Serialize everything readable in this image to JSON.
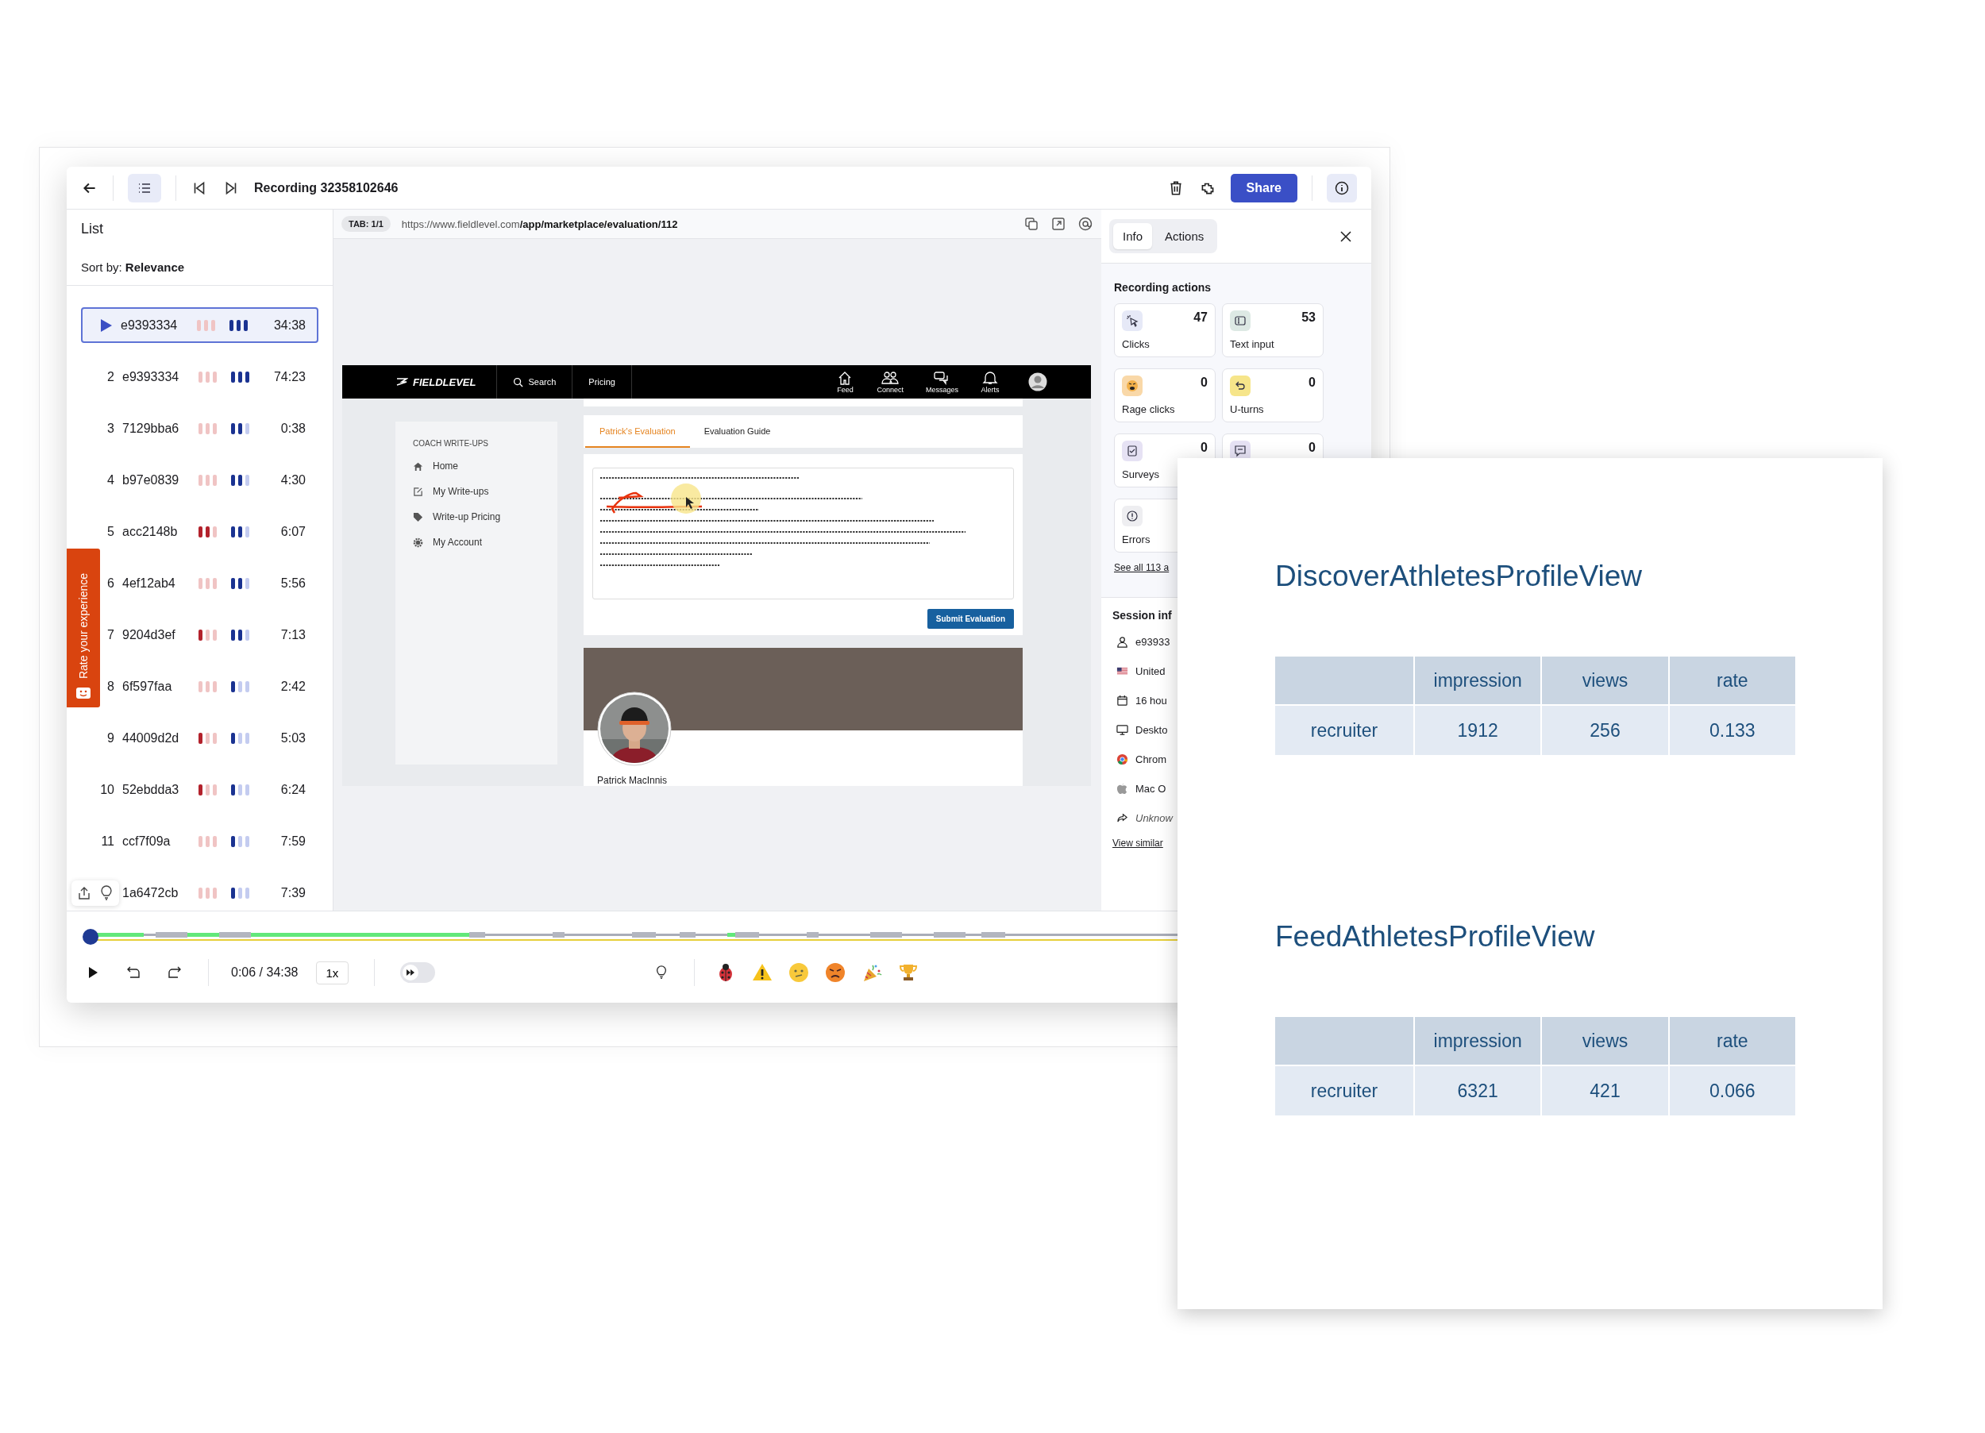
{
  "toolbar": {
    "title": "Recording 32358102646",
    "share_button": "Share"
  },
  "list": {
    "title": "List",
    "sort_label": "Sort by: **Relevance**",
    "items": [
      {
        "id": "e9393334",
        "duration": "34:38",
        "selected": true,
        "frustration": [
          {
            "filled": false
          },
          {
            "filled": false
          },
          {
            "filled": false
          }
        ],
        "engagement": [
          {
            "filled": true
          },
          {
            "filled": true
          },
          {
            "filled": true
          }
        ]
      },
      {
        "index": "2",
        "id": "e9393334",
        "duration": "74:23",
        "selected": false,
        "frustration": [
          {
            "filled": false
          },
          {
            "filled": false
          },
          {
            "filled": false
          }
        ],
        "engagement": [
          {
            "filled": true
          },
          {
            "filled": true
          },
          {
            "filled": true
          }
        ]
      },
      {
        "index": "3",
        "id": "7129bba6",
        "duration": "0:38",
        "selected": false,
        "frustration": [
          {
            "filled": false
          },
          {
            "filled": false
          },
          {
            "filled": false
          }
        ],
        "engagement": [
          {
            "filled": true
          },
          {
            "filled": true
          },
          {
            "filled": false
          }
        ]
      },
      {
        "index": "4",
        "id": "b97e0839",
        "duration": "4:30",
        "selected": false,
        "frustration": [
          {
            "filled": false
          },
          {
            "filled": false
          },
          {
            "filled": false
          }
        ],
        "engagement": [
          {
            "filled": true
          },
          {
            "filled": true
          },
          {
            "filled": false
          }
        ]
      },
      {
        "index": "5",
        "id": "acc2148b",
        "duration": "6:07",
        "selected": false,
        "frustration": [
          {
            "filled": true
          },
          {
            "filled": true
          },
          {
            "filled": false
          }
        ],
        "engagement": [
          {
            "filled": true
          },
          {
            "filled": true
          },
          {
            "filled": false
          }
        ]
      },
      {
        "index": "6",
        "id": "4ef12ab4",
        "duration": "5:56",
        "selected": false,
        "frustration": [
          {
            "filled": false
          },
          {
            "filled": false
          },
          {
            "filled": false
          }
        ],
        "engagement": [
          {
            "filled": true
          },
          {
            "filled": true
          },
          {
            "filled": false
          }
        ]
      },
      {
        "index": "7",
        "id": "9204d3ef",
        "duration": "7:13",
        "selected": false,
        "frustration": [
          {
            "filled": true
          },
          {
            "filled": false
          },
          {
            "filled": false
          }
        ],
        "engagement": [
          {
            "filled": true
          },
          {
            "filled": true
          },
          {
            "filled": false
          }
        ]
      },
      {
        "index": "8",
        "id": "6f597faa",
        "duration": "2:42",
        "selected": false,
        "frustration": [
          {
            "filled": false
          },
          {
            "filled": false
          },
          {
            "filled": false
          }
        ],
        "engagement": [
          {
            "filled": true
          },
          {
            "filled": false
          },
          {
            "filled": false
          }
        ]
      },
      {
        "index": "9",
        "id": "44009d2d",
        "duration": "5:03",
        "selected": false,
        "frustration": [
          {
            "filled": true
          },
          {
            "filled": false
          },
          {
            "filled": false
          }
        ],
        "engagement": [
          {
            "filled": true
          },
          {
            "filled": false
          },
          {
            "filled": false
          }
        ]
      },
      {
        "index": "10",
        "id": "52ebdda3",
        "duration": "6:24",
        "selected": false,
        "frustration": [
          {
            "filled": true
          },
          {
            "filled": false
          },
          {
            "filled": false
          }
        ],
        "engagement": [
          {
            "filled": true
          },
          {
            "filled": false
          },
          {
            "filled": false
          }
        ]
      },
      {
        "index": "11",
        "id": "ccf7f09a",
        "duration": "7:59",
        "selected": false,
        "frustration": [
          {
            "filled": false
          },
          {
            "filled": false
          },
          {
            "filled": false
          }
        ],
        "engagement": [
          {
            "filled": true
          },
          {
            "filled": false
          },
          {
            "filled": false
          }
        ]
      },
      {
        "id": "1a6472cb",
        "duration": "7:39",
        "selected": false,
        "frustration": [
          {
            "filled": false
          },
          {
            "filled": false
          },
          {
            "filled": false
          }
        ],
        "engagement": [
          {
            "filled": true
          },
          {
            "filled": false
          },
          {
            "filled": false
          }
        ]
      }
    ]
  },
  "feedback_tab": {
    "label": "Rate your experience"
  },
  "viewer": {
    "tab_badge": "TAB: 1/1",
    "url": "https://www.fieldlevel.com**/app/marketplace/evaluation/112**"
  },
  "embedded_page": {
    "brand": "FIELDLEVEL",
    "nav_links": [
      "Search",
      "Pricing"
    ],
    "nav_icons": [
      {
        "kind": "home",
        "label": "Feed"
      },
      {
        "kind": "people",
        "label": "Connect"
      },
      {
        "kind": "chat",
        "label": "Messages"
      },
      {
        "kind": "bell",
        "label": "Alerts"
      }
    ],
    "sidebar": {
      "heading": "COACH WRITE-UPS",
      "items": [
        {
          "kind": "home",
          "label": "Home"
        },
        {
          "kind": "edit",
          "label": "My Write-ups"
        },
        {
          "kind": "tag",
          "label": "Write-up Pricing"
        },
        {
          "kind": "gear",
          "label": "My Account"
        }
      ]
    },
    "tabs": [
      {
        "label": "Patrick's Evaluation",
        "selected": true
      },
      {
        "label": "Evaluation Guide",
        "selected": false
      }
    ],
    "submit_button": "Submit Evaluation",
    "profile_name": "Patrick MacInnis"
  },
  "info_panel": {
    "tabs": [
      {
        "label": "Info",
        "selected": true
      },
      {
        "label": "Actions",
        "selected": false
      }
    ],
    "section_title": "Recording actions",
    "actions": [
      {
        "kind": "clicks",
        "label": "Clicks",
        "count": "47"
      },
      {
        "kind": "text",
        "label": "Text input",
        "count": "53"
      },
      {
        "kind": "rage",
        "label": "Rage clicks",
        "count": "0"
      },
      {
        "kind": "uturn",
        "label": "U-turns",
        "count": "0"
      },
      {
        "kind": "survey",
        "label": "Surveys",
        "count": "0"
      },
      {
        "kind": "feedback",
        "count": "0"
      },
      {
        "kind": "error",
        "label": "Errors"
      }
    ],
    "see_all_link": "See all 113 a",
    "session_title": "Session inf",
    "session_rows": [
      {
        "kind": "user",
        "text": "e93933"
      },
      {
        "kind": "flag",
        "text": "United"
      },
      {
        "kind": "calendar",
        "text": "16 hou"
      },
      {
        "kind": "desktop",
        "text": "Deskto"
      },
      {
        "kind": "chrome",
        "text": "Chrom"
      },
      {
        "kind": "apple",
        "text": "Mac O"
      },
      {
        "kind": "referrer",
        "text": "Unknow"
      }
    ],
    "view_similar_link": "View similar"
  },
  "player_controls": {
    "time": "0:06 / 34:38",
    "speed": "1x",
    "skip_inactivity": {
      "on": false
    },
    "event_icons": [
      {
        "kind": "bug"
      },
      {
        "kind": "warning"
      },
      {
        "kind": "confused"
      },
      {
        "kind": "angry"
      },
      {
        "kind": "party"
      },
      {
        "kind": "trophy"
      }
    ]
  },
  "overlay": {
    "tables": [
      {
        "title": "DiscoverAthletesProfileView",
        "columns": [
          "impression",
          "views",
          "rate"
        ],
        "rows": [
          {
            "label": "recruiter",
            "values": [
              "1912",
              "256",
              "0.133"
            ]
          }
        ]
      },
      {
        "title": "FeedAthletesProfileView",
        "columns": [
          "impression",
          "views",
          "rate"
        ],
        "rows": [
          {
            "label": "recruiter",
            "values": [
              "6321",
              "421",
              "0.066"
            ]
          }
        ]
      }
    ]
  }
}
